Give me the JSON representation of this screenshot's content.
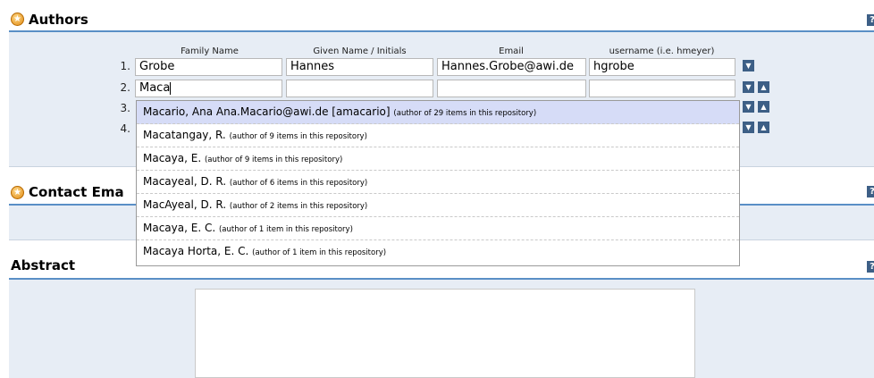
{
  "authors": {
    "title": "Authors",
    "columns": [
      "Family Name",
      "Given Name / Initials",
      "Email",
      "username (i.e. hmeyer)"
    ],
    "rows": [
      {
        "num": "1.",
        "family": "Grobe",
        "given": "Hannes",
        "email": "Hannes.Grobe@awi.de",
        "username": "hgrobe"
      },
      {
        "num": "2.",
        "family": "Maca",
        "given": "",
        "email": "",
        "username": ""
      },
      {
        "num": "3.",
        "family": "",
        "given": "",
        "email": "",
        "username": ""
      },
      {
        "num": "4.",
        "family": "",
        "given": "",
        "email": "",
        "username": ""
      }
    ]
  },
  "autocomplete": [
    {
      "name": "Macario, Ana Ana.Macario@awi.de [amacario]",
      "note": "(author of 29 items in this repository)",
      "selected": true
    },
    {
      "name": "Macatangay, R.",
      "note": "(author of 9 items in this repository)"
    },
    {
      "name": "Macaya, E.",
      "note": "(author of 9 items in this repository)"
    },
    {
      "name": "Macayeal, D. R.",
      "note": "(author of 6 items in this repository)"
    },
    {
      "name": "MacAyeal, D. R.",
      "note": "(author of 2 items in this repository)"
    },
    {
      "name": "Macaya, E. C.",
      "note": "(author of 1 item in this repository)"
    },
    {
      "name": "Macaya Horta, E. C.",
      "note": "(author of 1 item in this repository)"
    }
  ],
  "contact": {
    "title": "Contact Ema"
  },
  "abstract": {
    "title": "Abstract"
  },
  "icons": {
    "help": "?",
    "star": "★",
    "down": "▼",
    "up": "▲"
  },
  "colors": {
    "accent_rule": "#5a8fc6",
    "panel_bg": "#e7edf5",
    "selected_suggestion": "#d6dcf7",
    "button": "#3d5f86",
    "star": "#e08a12"
  }
}
